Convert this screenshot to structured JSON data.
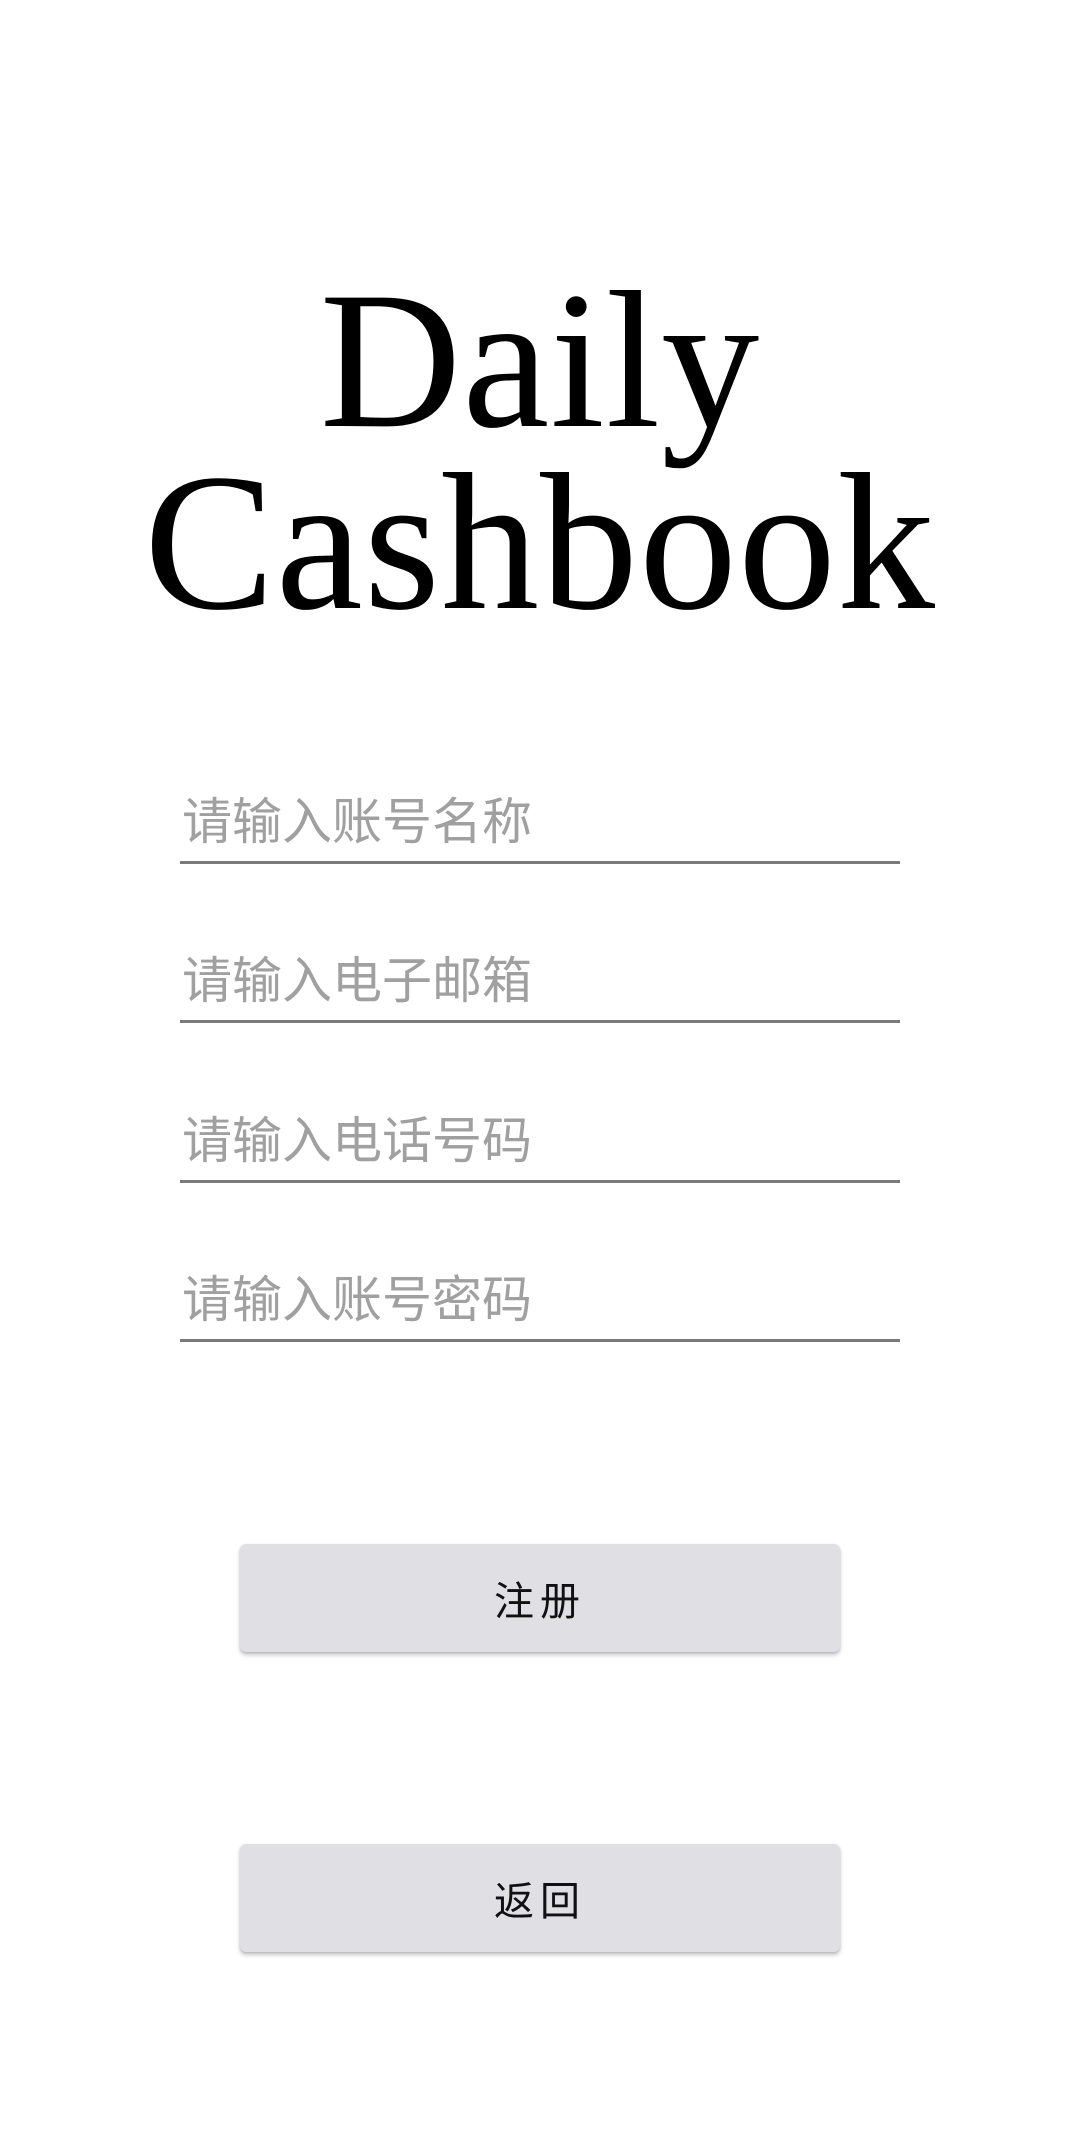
{
  "logo": {
    "line1": "Daily",
    "line2": "Cashbook"
  },
  "form": {
    "account_name_placeholder": "请输入账号名称",
    "email_placeholder": "请输入电子邮箱",
    "phone_placeholder": "请输入电话号码",
    "password_placeholder": "请输入账号密码",
    "account_name_value": "",
    "email_value": "",
    "phone_value": "",
    "password_value": ""
  },
  "actions": {
    "register_label": "注册",
    "back_label": "返回"
  },
  "colors": {
    "background": "#ffffff",
    "button_background": "#e0e0e4",
    "placeholder": "#a0a0a0",
    "underline": "#7a7a7a",
    "text": "#000000"
  }
}
